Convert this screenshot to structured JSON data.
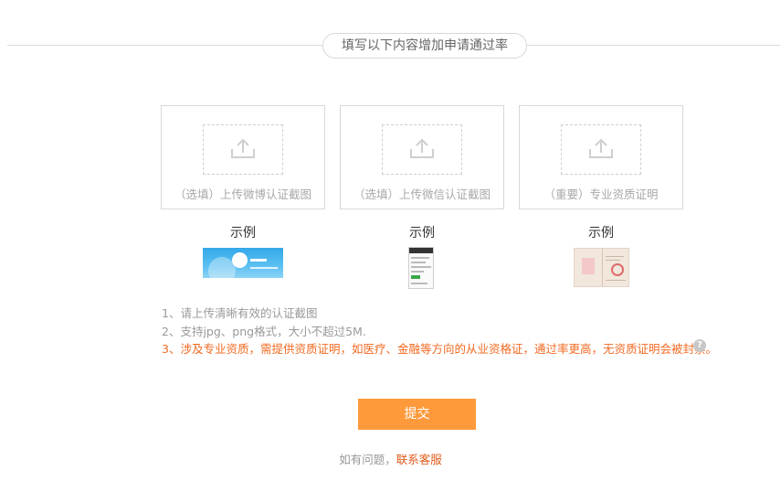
{
  "header": {
    "title": "填写以下内容增加申请通过率"
  },
  "uploads": [
    {
      "label": "（选填）上传微博认证截图",
      "example_label": "示例"
    },
    {
      "label": "（选填）上传微信认证截图",
      "example_label": "示例"
    },
    {
      "label": "（重要）专业资质证明",
      "example_label": "示例"
    }
  ],
  "icons": {
    "upload": "upload-icon",
    "help": "question-circle-icon"
  },
  "notes": [
    "1、请上传清晰有效的认证截图",
    "2、支持jpg、png格式，大小不超过5M.",
    "3、涉及专业资质，需提供资质证明，如医疗、金融等方向的从业资格证，通过率更高，无资质证明会被封禁。"
  ],
  "help_glyph": "?",
  "submit": {
    "label": "提交"
  },
  "footer": {
    "prefix": "如有问题，",
    "link": "联系客服"
  },
  "colors": {
    "accent": "#ff9a3c",
    "warning": "#f26a22",
    "link": "#e05a1a"
  }
}
